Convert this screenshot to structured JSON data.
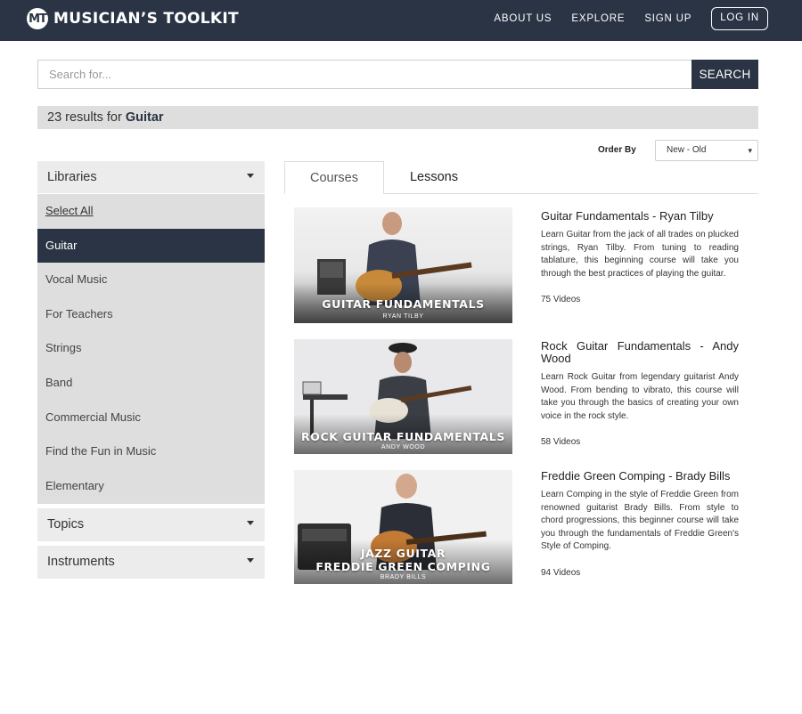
{
  "header": {
    "logo_mark": "MT",
    "brand": "MUSICIAN’S TOOLKIT",
    "nav": [
      "ABOUT US",
      "EXPLORE",
      "SIGN UP"
    ],
    "login": "LOG IN"
  },
  "search": {
    "placeholder": "Search for...",
    "button": "SEARCH"
  },
  "results": {
    "prefix": "23 results for",
    "query": "Guitar"
  },
  "order": {
    "label": "Order By",
    "selected": "New - Old"
  },
  "sidebar": {
    "libraries": "Libraries",
    "select_all": "Select All",
    "items": [
      "Guitar",
      "Vocal Music",
      "For Teachers",
      "Strings",
      "Band",
      "Commercial Music",
      "Find the Fun in Music",
      "Elementary"
    ],
    "topics": "Topics",
    "instruments": "Instruments"
  },
  "tabs": {
    "courses": "Courses",
    "lessons": "Lessons"
  },
  "courses": [
    {
      "title": "Guitar Fundamentals - Ryan Tilby",
      "description": "Learn Guitar from the jack of all trades on plucked strings, Ryan Tilby. From tuning to reading tablature, this beginning course will take you through the best practices of playing the guitar.",
      "videos": "75 Videos",
      "thumb_title": "GUITAR FUNDAMENTALS",
      "thumb_sub": "RYAN TILBY"
    },
    {
      "title": "Rock Guitar Fundamentals - Andy Wood",
      "description": "Learn Rock Guitar from legendary guitarist Andy Wood. From bending to vibrato, this course will take you through the basics of creating your own voice in the rock style.",
      "videos": "58 Videos",
      "thumb_title": "ROCK GUITAR FUNDAMENTALS",
      "thumb_sub": "ANDY WOOD"
    },
    {
      "title": "Freddie Green Comping - Brady Bills",
      "description": "Learn Comping in the style of Freddie Green from renowned guitarist Brady Bills. From style to chord progressions, this beginner course will take you through the fundamentals of Freddie Green's Style of Comping.",
      "videos": "94 Videos",
      "thumb_title_1": "JAZZ GUITAR",
      "thumb_title_2": "FREDDIE GREEN COMPING",
      "thumb_sub": "BRADY BILLS"
    }
  ],
  "colors": {
    "navy": "#2b3444",
    "sidebar_bg": "#dedede",
    "header_bg": "#ececec"
  }
}
